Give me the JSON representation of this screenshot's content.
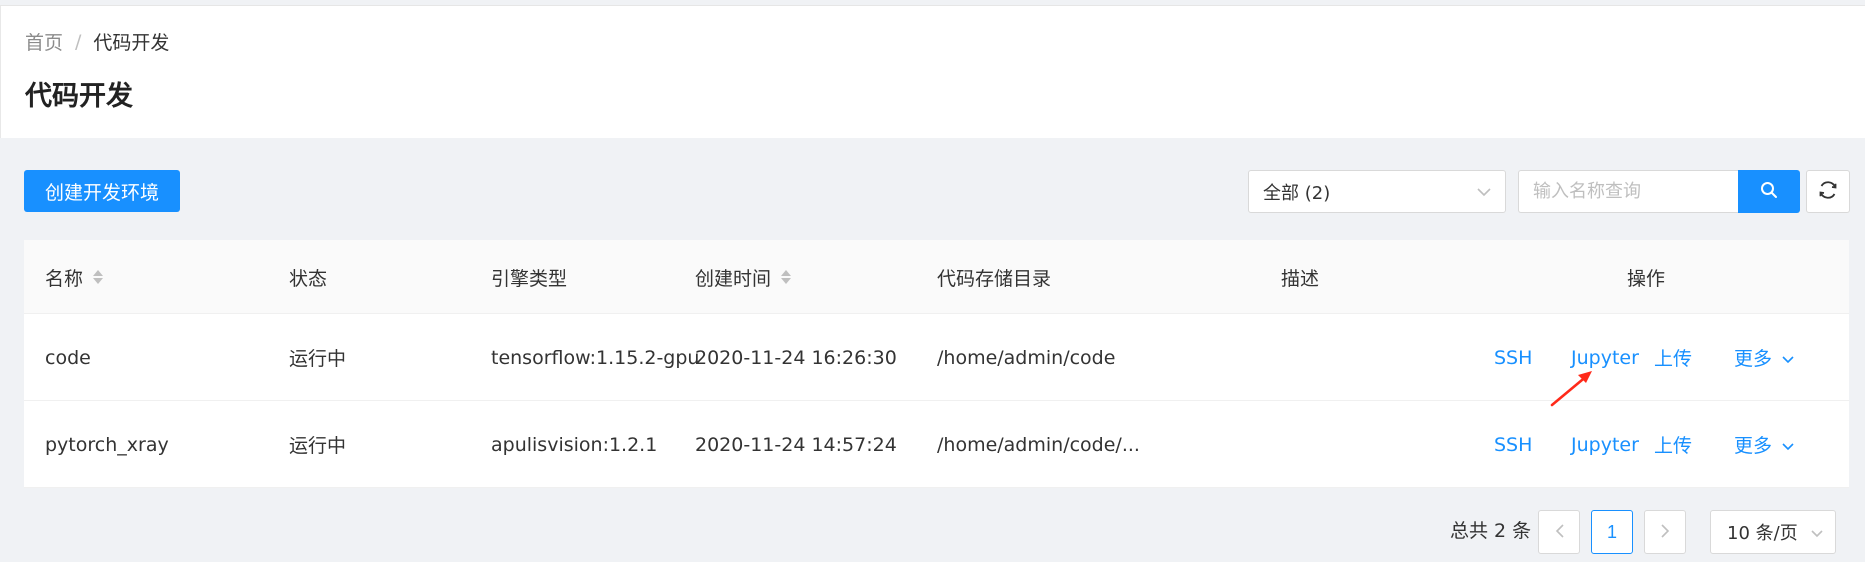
{
  "breadcrumb": {
    "home": "首页",
    "separator": "/",
    "current": "代码开发"
  },
  "page_title": "代码开发",
  "toolbar": {
    "create_label": "创建开发环境",
    "filter_selected": "全部 (2)",
    "search_placeholder": "输入名称查询"
  },
  "table": {
    "headers": {
      "name": "名称",
      "status": "状态",
      "engine": "引擎类型",
      "created": "创建时间",
      "dir": "代码存储目录",
      "desc": "描述",
      "ops": "操作"
    },
    "rows": [
      {
        "name": "code",
        "status": "运行中",
        "engine": "tensorflow:1.15.2-gpu",
        "created": "2020-11-24 16:26:30",
        "dir": "/home/admin/code",
        "desc": "",
        "ssh": "SSH",
        "jupyter": "Jupyter",
        "upload": "上传",
        "more": "更多"
      },
      {
        "name": "pytorch_xray",
        "status": "运行中",
        "engine": "apulisvision:1.2.1",
        "created": "2020-11-24 14:57:24",
        "dir": "/home/admin/code/...",
        "desc": "",
        "ssh": "SSH",
        "jupyter": "Jupyter",
        "upload": "上传",
        "more": "更多"
      }
    ]
  },
  "pagination": {
    "total": "总共 2 条",
    "current_page": "1",
    "page_size": "10 条/页"
  },
  "colors": {
    "primary": "#1890ff",
    "annotation_arrow": "#ff2a1a"
  }
}
